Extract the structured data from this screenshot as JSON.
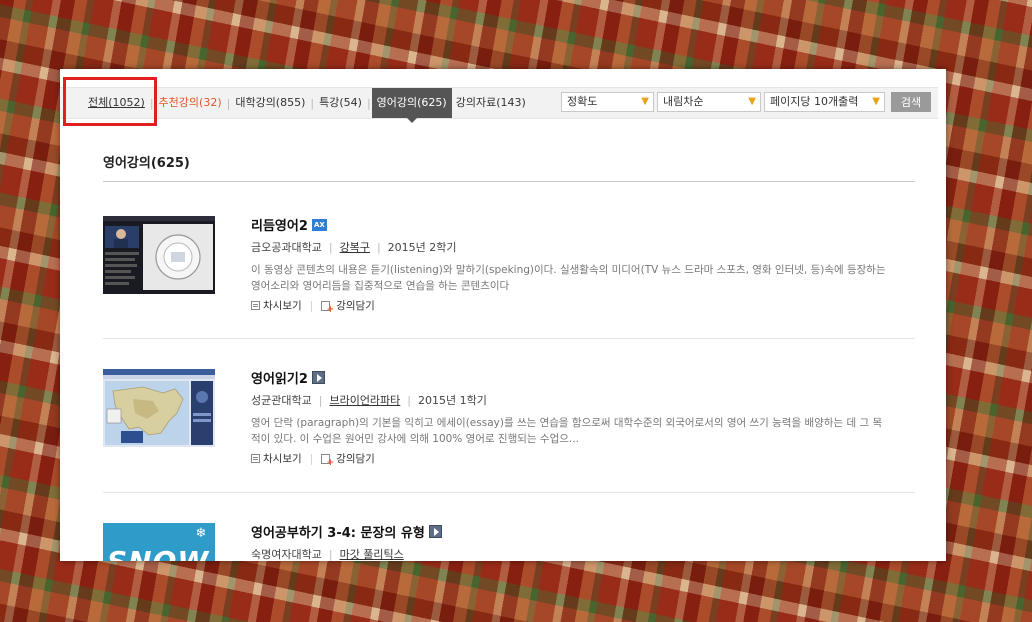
{
  "tabs": [
    {
      "label": "전체(1052)"
    },
    {
      "label": "추천강의(32)"
    },
    {
      "label": "대학강의(855)"
    },
    {
      "label": "특강(54)"
    },
    {
      "label": "영어강의(625)"
    },
    {
      "label": "강의자료(143)"
    }
  ],
  "filters": {
    "sort_by": "정확도",
    "order": "내림차순",
    "per_page": "페이지당 10개출력",
    "search_label": "검색"
  },
  "section_title": "영어강의(625)",
  "courses": [
    {
      "title": "리듬영어2",
      "badge": "AX",
      "university": "금오공과대학교",
      "professor": "강복구",
      "term": "2015년 2학기",
      "description": "이 동영상 콘텐츠의 내용은 듣기(listening)와 말하기(speking)이다. 실생활속의 미디어(TV 뉴스 드라마 스포츠, 영화 인터넷, 등)속에 등장하는 영어소리와 영어리듬을 집중적으로 연습을 하는 콘텐츠이다",
      "episodes_label": "차시보기",
      "add_label": "강의담기"
    },
    {
      "title": "영어읽기2",
      "university": "성균관대학교",
      "professor": "브라이언라파타",
      "term": "2015년 1학기",
      "description": "영어 단락 (paragraph)의 기본을 익히고 에세이(essay)를 쓰는 연습을 함으로써 대학수준의 외국어로서의 영어 쓰기 능력을 배양하는 데 그 목적이 있다. 이 수업은 원어민 강사에 의해 100% 영어로 진행되는 수업으...",
      "episodes_label": "차시보기",
      "add_label": "강의담기"
    },
    {
      "title": "영어공부하기 3-4: 문장의 유형",
      "university": "숙명여자대학교",
      "professor": "마갓 풀리틱스",
      "thumb_text": "SNOW"
    }
  ]
}
